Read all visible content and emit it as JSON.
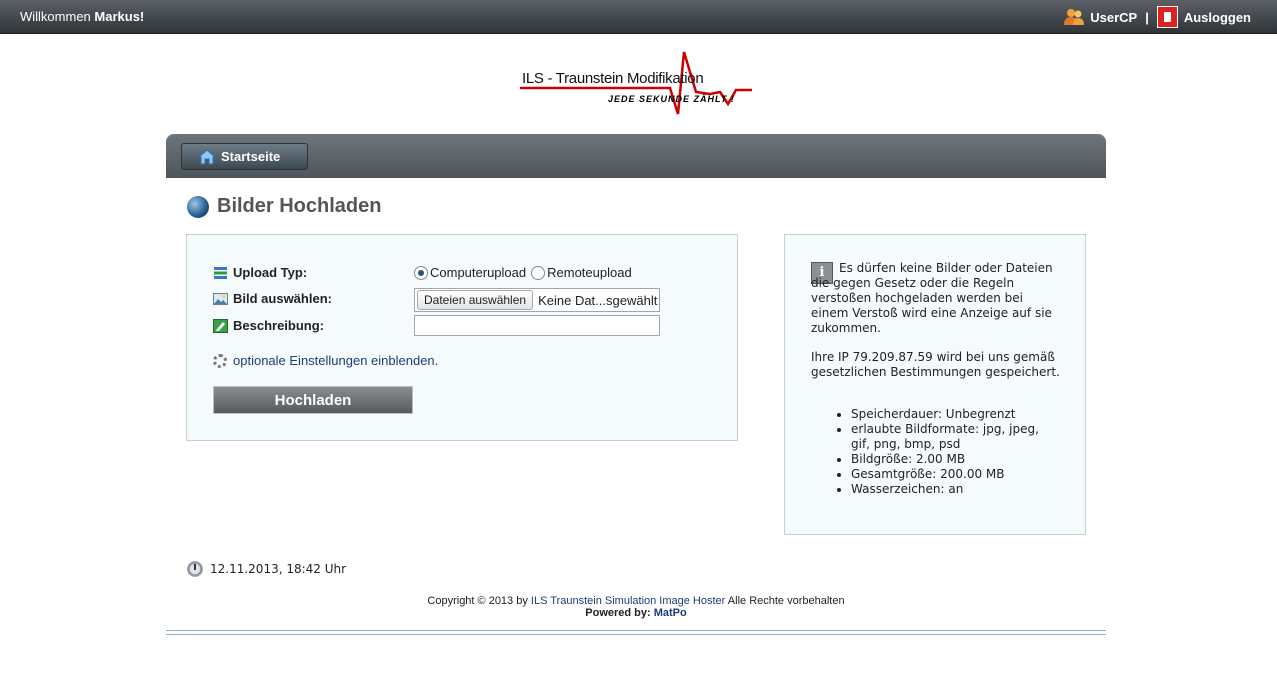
{
  "topbar": {
    "welcome_prefix": "Willkommen ",
    "welcome_name": "Markus!",
    "usercp_label": "UserCP",
    "separator": "|",
    "logout_label": "Ausloggen"
  },
  "logo": {
    "title": "ILS - Traunstein Modifikation",
    "tagline": "JEDE SEKUNDE ZÄHLT !"
  },
  "nav": {
    "home_label": "Startseite"
  },
  "page": {
    "title": "Bilder Hochladen"
  },
  "form": {
    "upload_type_label": "Upload Typ:",
    "radio_computer": "Computerupload",
    "radio_remote": "Remoteupload",
    "selected": "Computerupload",
    "select_image_label": "Bild auswählen:",
    "file_button": "Dateien auswählen",
    "file_status": "Keine Dat...sgewählt",
    "description_label": "Beschreibung:",
    "description_value": "",
    "options_link": "optionale Einstellungen einblenden.",
    "submit_label": "Hochladen"
  },
  "info": {
    "para1": "Es dürfen keine Bilder oder Dateien die gegen Gesetz oder die Regeln verstoßen hochgeladen werden bei einem Verstoß wird eine Anzeige auf sie zukommen.",
    "para2": "Ihre IP 79.209.87.59 wird bei uns gemäß gesetzlichen Bestimmungen gespeichert.",
    "items": [
      "Speicherdauer: Unbegrenzt",
      "erlaubte Bildformate: jpg, jpeg, gif, png, bmp, psd",
      "Bildgröße: 2.00 MB",
      "Gesamtgröße: 200.00 MB",
      "Wasserzeichen: an"
    ]
  },
  "datetime": "12.11.2013, 18:42 Uhr",
  "footer": {
    "copyright_prefix": "Copyright © 2013 by ",
    "copyright_link": "ILS Traunstein Simulation Image Hoster",
    "copyright_suffix": " Alle Rechte vorbehalten",
    "powered_prefix": "Powered by: ",
    "powered_link": "MatPo"
  },
  "colors": {
    "topbar": "#3f4549",
    "navbar": "#5d656b",
    "link": "#1d3c78",
    "logo_red": "#cc0000",
    "box_bg": "#f5fafc"
  }
}
